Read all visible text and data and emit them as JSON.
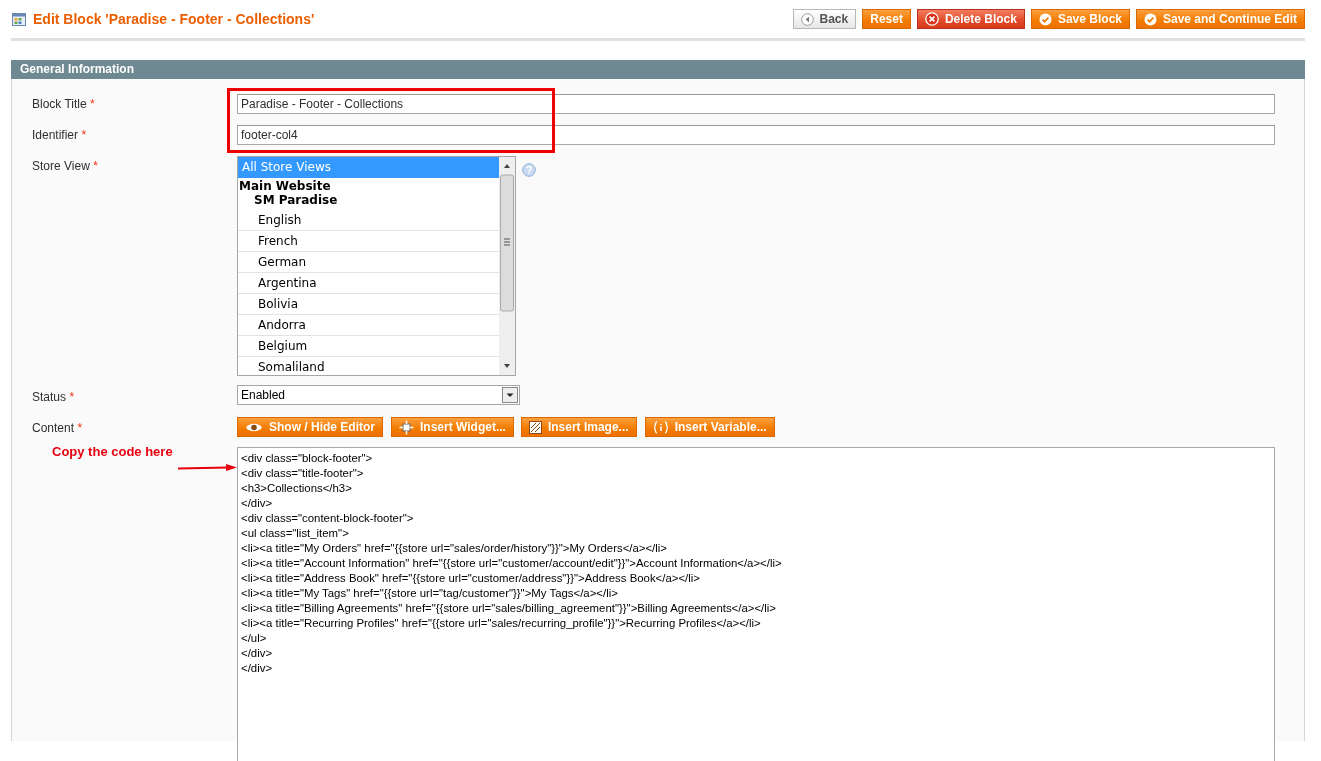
{
  "page_title": "Edit Block 'Paradise - Footer - Collections'",
  "header_buttons": [
    {
      "kind": "back",
      "label": "Back"
    },
    {
      "kind": "reset",
      "label": "Reset"
    },
    {
      "kind": "delete",
      "label": "Delete Block"
    },
    {
      "kind": "save",
      "label": "Save Block"
    },
    {
      "kind": "save",
      "label": "Save and Continue Edit"
    }
  ],
  "section": {
    "title": "General Information",
    "fields": [
      {
        "kind": "text",
        "label": "Block Title",
        "required_mark": "*",
        "value": "Paradise - Footer - Collections"
      },
      {
        "kind": "text",
        "label": "Identifier",
        "required_mark": "*",
        "value": "footer-col4"
      },
      {
        "kind": "multiselect",
        "label": "Store View",
        "required_mark": "*",
        "options": [
          {
            "kind": "option",
            "label": "All Store Views",
            "selected": true
          },
          {
            "kind": "group",
            "label": "Main Website",
            "selected": false
          },
          {
            "kind": "subgroup",
            "label": "SM Paradise",
            "selected": false
          },
          {
            "kind": "option",
            "label": "English",
            "selected": false
          },
          {
            "kind": "option",
            "label": "French",
            "selected": false
          },
          {
            "kind": "option",
            "label": "German",
            "selected": false
          },
          {
            "kind": "option",
            "label": "Argentina",
            "selected": false
          },
          {
            "kind": "option",
            "label": "Bolivia",
            "selected": false
          },
          {
            "kind": "option",
            "label": "Andorra",
            "selected": false
          },
          {
            "kind": "option",
            "label": "Belgium",
            "selected": false
          },
          {
            "kind": "option",
            "label": "Somaliland",
            "selected": false
          }
        ]
      },
      {
        "kind": "select",
        "label": "Status",
        "required_mark": "*",
        "value": "Enabled"
      },
      {
        "kind": "editor",
        "label": "Content",
        "required_mark": "*",
        "buttons": [
          {
            "kind": "editor",
            "label": "Show / Hide Editor"
          },
          {
            "kind": "widget",
            "label": "Insert Widget..."
          },
          {
            "kind": "image",
            "label": "Insert Image..."
          },
          {
            "kind": "variable",
            "label": "Insert Variable..."
          }
        ],
        "code_lines": [
          "<div class=\"block-footer\">",
          "<div class=\"title-footer\">",
          "<h3>Collections</h3>",
          "</div>",
          "<div class=\"content-block-footer\">",
          "<ul class=\"list_item\">",
          "<li><a title=\"My Orders\" href=\"{{store url=\"sales/order/history\"}}\">My Orders</a></li>",
          "<li><a title=\"Account Information\" href=\"{{store url=\"customer/account/edit\"}}\">Account Information</a></li>",
          "<li><a title=\"Address Book\" href=\"{{store url=\"customer/address\"}}\">Address Book</a></li>",
          "<li><a title=\"My Tags\" href=\"{{store url=\"tag/customer\"}}\">My Tags</a></li>",
          "<li><a title=\"Billing Agreements\" href=\"{{store url=\"sales/billing_agreement\"}}\">Billing Agreements</a></li>",
          "<li><a title=\"Recurring Profiles\" href=\"{{store url=\"sales/recurring_profile\"}}\">Recurring Profiles</a></li>",
          "</ul>",
          "</div>",
          "</div>"
        ]
      }
    ]
  },
  "annotations": {
    "note": "Copy the code here"
  }
}
